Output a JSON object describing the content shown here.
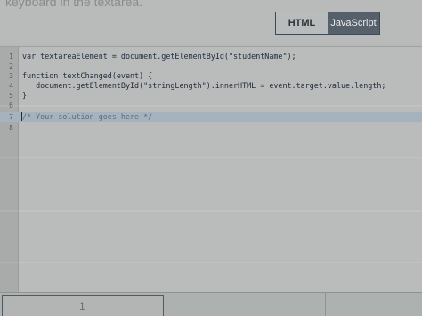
{
  "prompt_text": "keyboard in the textarea.",
  "tabs": {
    "html_label": "HTML",
    "js_label": "JavaScript"
  },
  "editor": {
    "lines": [
      {
        "num": "1",
        "text": "var textareaElement = document.getElementById(\"studentName\");"
      },
      {
        "num": "2",
        "text": ""
      },
      {
        "num": "3",
        "text": "function textChanged(event) {"
      },
      {
        "num": "4",
        "text": "   document.getElementById(\"stringLength\").innerHTML = event.target.value.length;"
      },
      {
        "num": "5",
        "text": "}"
      },
      {
        "num": "6",
        "text": ""
      },
      {
        "num": "7",
        "text": "/* Your solution goes here */"
      },
      {
        "num": "8",
        "text": ""
      }
    ]
  },
  "bottom": {
    "indicator": "1"
  }
}
